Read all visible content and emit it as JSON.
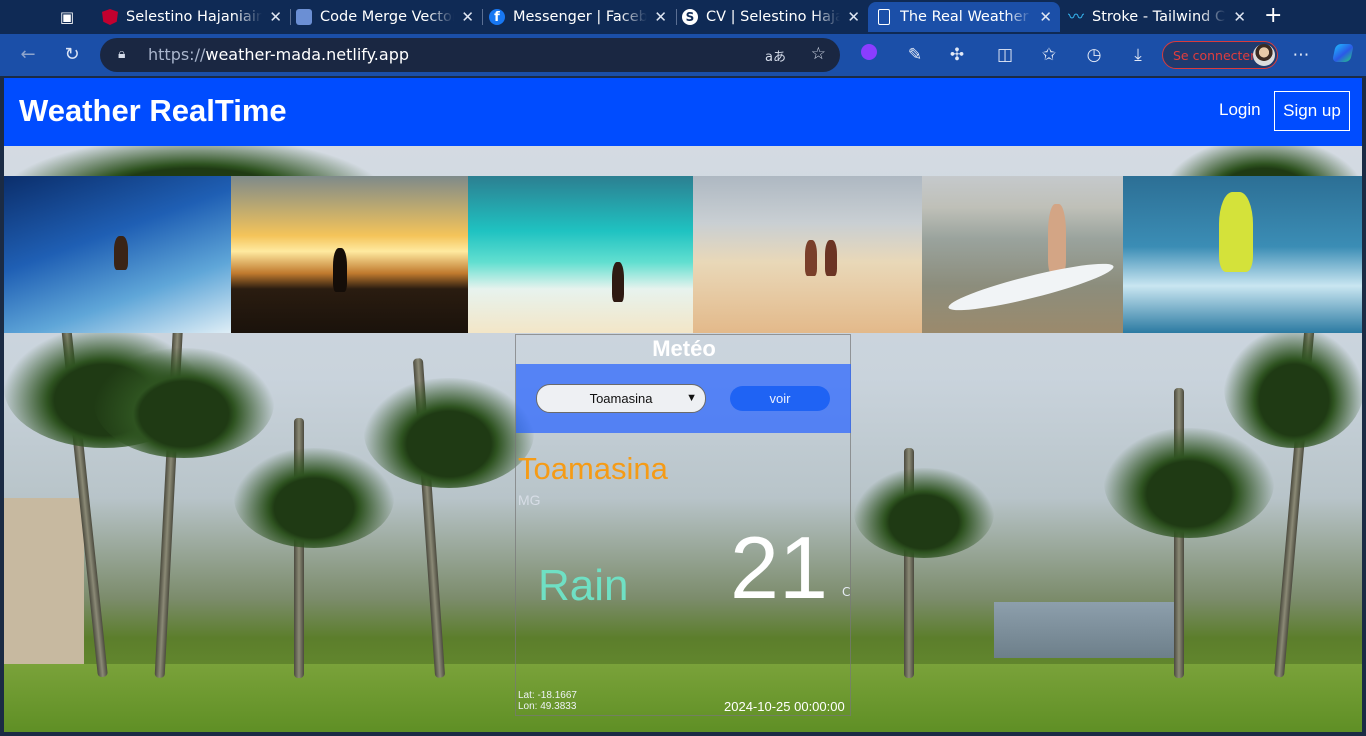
{
  "browser": {
    "tabs": [
      {
        "title": "Selestino Hajaniaina",
        "icon": "angular-icon",
        "color": "#c3002f"
      },
      {
        "title": "Code Merge Vector",
        "icon": "merge-icon",
        "color": "#5f8bd6"
      },
      {
        "title": "Messenger | Facebook",
        "icon": "facebook-icon",
        "color": "#1877f2"
      },
      {
        "title": "CV | Selestino Hajaniaina",
        "icon": "s-logo-icon",
        "color": "#ffffff"
      },
      {
        "title": "The Real Weather",
        "icon": "page-icon",
        "color": "#ffffff"
      },
      {
        "title": "Stroke - Tailwind CSS",
        "icon": "tailwind-icon",
        "color": "#38bdf8"
      }
    ],
    "active_tab_index": 4,
    "url_protocol": "https://",
    "url_host": "weather-mada.netlify.app",
    "signin_label": "Se connecter"
  },
  "navbar": {
    "brand": "Weather RealTime",
    "login": "Login",
    "signup": "Sign up"
  },
  "card": {
    "title": "Metéo",
    "selected_city": "Toamasina",
    "submit_label": "voir",
    "city": "Toamasina",
    "country": "MG",
    "condition": "Rain",
    "temperature": "21",
    "temperature_unit": "C",
    "lat": "Lat: -18.1667",
    "lon": "Lon: 49.3833",
    "datetime": "2024-10-25 00:00:00"
  },
  "colors": {
    "navbar": "#004cff",
    "city_name": "#f59b16",
    "condition": "#6fe0c4",
    "submit": "#1f63f4"
  }
}
